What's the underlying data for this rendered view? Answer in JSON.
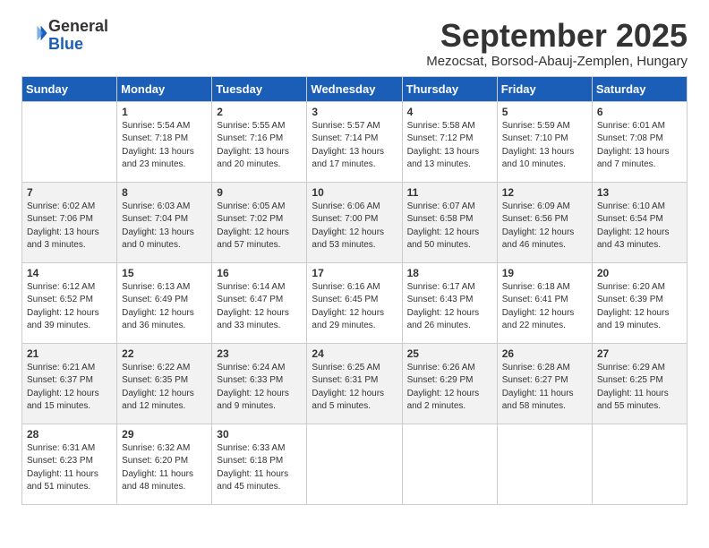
{
  "header": {
    "logo_general": "General",
    "logo_blue": "Blue",
    "month": "September 2025",
    "location": "Mezocsat, Borsod-Abauj-Zemplen, Hungary"
  },
  "days_of_week": [
    "Sunday",
    "Monday",
    "Tuesday",
    "Wednesday",
    "Thursday",
    "Friday",
    "Saturday"
  ],
  "weeks": [
    [
      {
        "day": "",
        "info": ""
      },
      {
        "day": "1",
        "info": "Sunrise: 5:54 AM\nSunset: 7:18 PM\nDaylight: 13 hours\nand 23 minutes."
      },
      {
        "day": "2",
        "info": "Sunrise: 5:55 AM\nSunset: 7:16 PM\nDaylight: 13 hours\nand 20 minutes."
      },
      {
        "day": "3",
        "info": "Sunrise: 5:57 AM\nSunset: 7:14 PM\nDaylight: 13 hours\nand 17 minutes."
      },
      {
        "day": "4",
        "info": "Sunrise: 5:58 AM\nSunset: 7:12 PM\nDaylight: 13 hours\nand 13 minutes."
      },
      {
        "day": "5",
        "info": "Sunrise: 5:59 AM\nSunset: 7:10 PM\nDaylight: 13 hours\nand 10 minutes."
      },
      {
        "day": "6",
        "info": "Sunrise: 6:01 AM\nSunset: 7:08 PM\nDaylight: 13 hours\nand 7 minutes."
      }
    ],
    [
      {
        "day": "7",
        "info": "Sunrise: 6:02 AM\nSunset: 7:06 PM\nDaylight: 13 hours\nand 3 minutes."
      },
      {
        "day": "8",
        "info": "Sunrise: 6:03 AM\nSunset: 7:04 PM\nDaylight: 13 hours\nand 0 minutes."
      },
      {
        "day": "9",
        "info": "Sunrise: 6:05 AM\nSunset: 7:02 PM\nDaylight: 12 hours\nand 57 minutes."
      },
      {
        "day": "10",
        "info": "Sunrise: 6:06 AM\nSunset: 7:00 PM\nDaylight: 12 hours\nand 53 minutes."
      },
      {
        "day": "11",
        "info": "Sunrise: 6:07 AM\nSunset: 6:58 PM\nDaylight: 12 hours\nand 50 minutes."
      },
      {
        "day": "12",
        "info": "Sunrise: 6:09 AM\nSunset: 6:56 PM\nDaylight: 12 hours\nand 46 minutes."
      },
      {
        "day": "13",
        "info": "Sunrise: 6:10 AM\nSunset: 6:54 PM\nDaylight: 12 hours\nand 43 minutes."
      }
    ],
    [
      {
        "day": "14",
        "info": "Sunrise: 6:12 AM\nSunset: 6:52 PM\nDaylight: 12 hours\nand 39 minutes."
      },
      {
        "day": "15",
        "info": "Sunrise: 6:13 AM\nSunset: 6:49 PM\nDaylight: 12 hours\nand 36 minutes."
      },
      {
        "day": "16",
        "info": "Sunrise: 6:14 AM\nSunset: 6:47 PM\nDaylight: 12 hours\nand 33 minutes."
      },
      {
        "day": "17",
        "info": "Sunrise: 6:16 AM\nSunset: 6:45 PM\nDaylight: 12 hours\nand 29 minutes."
      },
      {
        "day": "18",
        "info": "Sunrise: 6:17 AM\nSunset: 6:43 PM\nDaylight: 12 hours\nand 26 minutes."
      },
      {
        "day": "19",
        "info": "Sunrise: 6:18 AM\nSunset: 6:41 PM\nDaylight: 12 hours\nand 22 minutes."
      },
      {
        "day": "20",
        "info": "Sunrise: 6:20 AM\nSunset: 6:39 PM\nDaylight: 12 hours\nand 19 minutes."
      }
    ],
    [
      {
        "day": "21",
        "info": "Sunrise: 6:21 AM\nSunset: 6:37 PM\nDaylight: 12 hours\nand 15 minutes."
      },
      {
        "day": "22",
        "info": "Sunrise: 6:22 AM\nSunset: 6:35 PM\nDaylight: 12 hours\nand 12 minutes."
      },
      {
        "day": "23",
        "info": "Sunrise: 6:24 AM\nSunset: 6:33 PM\nDaylight: 12 hours\nand 9 minutes."
      },
      {
        "day": "24",
        "info": "Sunrise: 6:25 AM\nSunset: 6:31 PM\nDaylight: 12 hours\nand 5 minutes."
      },
      {
        "day": "25",
        "info": "Sunrise: 6:26 AM\nSunset: 6:29 PM\nDaylight: 12 hours\nand 2 minutes."
      },
      {
        "day": "26",
        "info": "Sunrise: 6:28 AM\nSunset: 6:27 PM\nDaylight: 11 hours\nand 58 minutes."
      },
      {
        "day": "27",
        "info": "Sunrise: 6:29 AM\nSunset: 6:25 PM\nDaylight: 11 hours\nand 55 minutes."
      }
    ],
    [
      {
        "day": "28",
        "info": "Sunrise: 6:31 AM\nSunset: 6:23 PM\nDaylight: 11 hours\nand 51 minutes."
      },
      {
        "day": "29",
        "info": "Sunrise: 6:32 AM\nSunset: 6:20 PM\nDaylight: 11 hours\nand 48 minutes."
      },
      {
        "day": "30",
        "info": "Sunrise: 6:33 AM\nSunset: 6:18 PM\nDaylight: 11 hours\nand 45 minutes."
      },
      {
        "day": "",
        "info": ""
      },
      {
        "day": "",
        "info": ""
      },
      {
        "day": "",
        "info": ""
      },
      {
        "day": "",
        "info": ""
      }
    ]
  ]
}
